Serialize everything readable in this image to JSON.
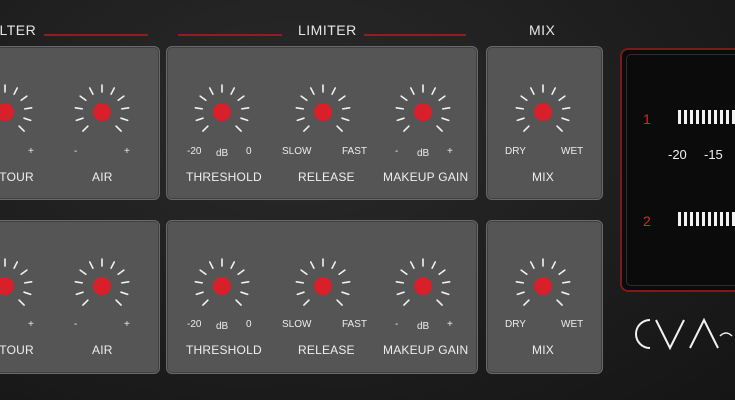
{
  "sections": {
    "filter": "FILTER",
    "limiter": "LIMITER",
    "mix": "MIX"
  },
  "row1": {
    "filter": {
      "contour": {
        "label": "CONTOUR",
        "min": "-",
        "max": "+"
      },
      "air": {
        "label": "AIR",
        "min": "-",
        "max": "+"
      }
    },
    "limiter": {
      "threshold": {
        "label": "THRESHOLD",
        "min": "-20",
        "unit": "dB",
        "max": "0"
      },
      "release": {
        "label": "RELEASE",
        "min": "SLOW",
        "max": "FAST"
      },
      "makeup": {
        "label": "MAKEUP GAIN",
        "min": "-",
        "unit": "dB",
        "max": "+"
      }
    },
    "mix": {
      "label": "MIX",
      "min": "DRY",
      "max": "WET"
    }
  },
  "row2": {
    "filter": {
      "contour": {
        "label": "CONTOUR",
        "min": "-",
        "max": "+"
      },
      "air": {
        "label": "AIR",
        "min": "-",
        "max": "+"
      }
    },
    "limiter": {
      "threshold": {
        "label": "THRESHOLD",
        "min": "-20",
        "unit": "dB",
        "max": "0"
      },
      "release": {
        "label": "RELEASE",
        "min": "SLOW",
        "max": "FAST"
      },
      "makeup": {
        "label": "MAKEUP GAIN",
        "min": "-",
        "unit": "dB",
        "max": "+"
      }
    },
    "mix": {
      "label": "MIX",
      "min": "DRY",
      "max": "WET"
    }
  },
  "meter": {
    "channel1": "1",
    "channel2": "2",
    "scale": [
      "-20",
      "-15"
    ]
  },
  "brand": {
    "logo_text": "CVA"
  },
  "colors": {
    "accent": "#d81f2a",
    "frame": "#7a1a1a",
    "panel": "#555555",
    "background": "#1e1e1e"
  }
}
